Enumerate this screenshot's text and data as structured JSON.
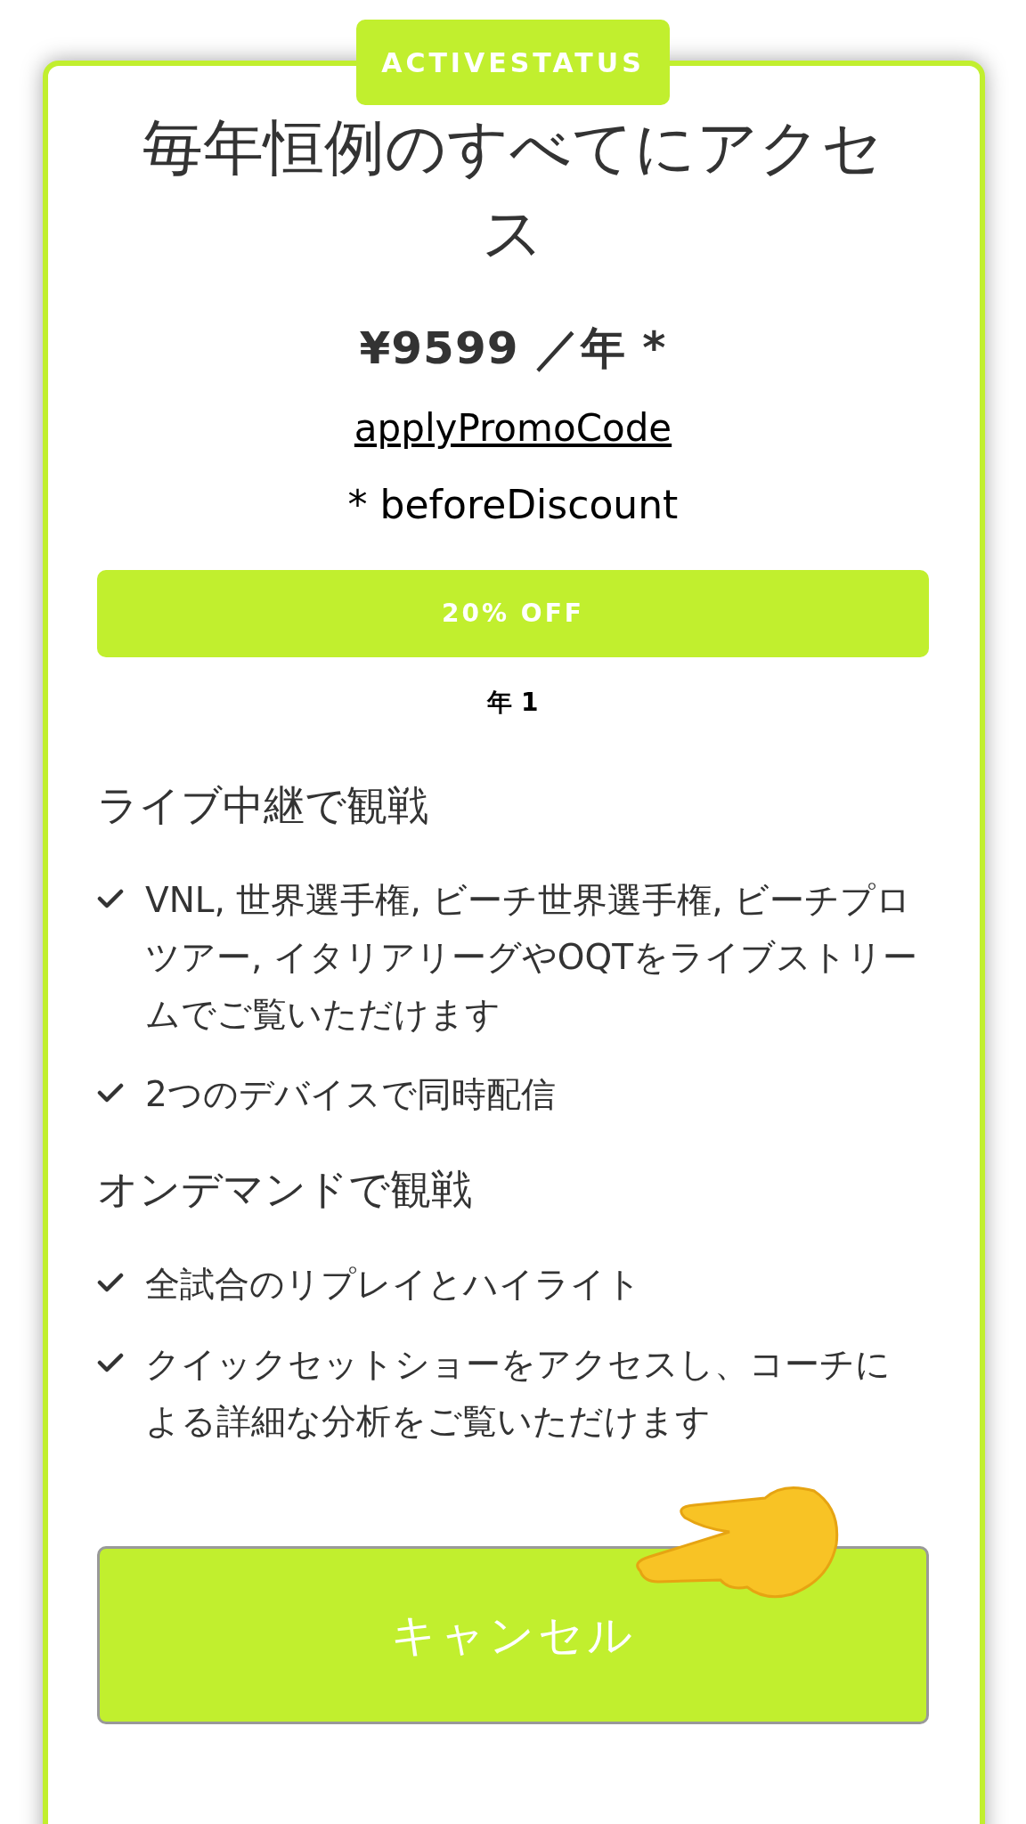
{
  "badge": "ACTIVESTATUS",
  "title": "毎年恒例のすべてにアクセス",
  "price": "¥9599 ／年 *",
  "promo_link": "applyPromoCode",
  "note": "* beforeDiscount",
  "discount_bar": "20% OFF",
  "period": "年 1",
  "sections": [
    {
      "heading": "ライブ中継で観戦",
      "items": [
        "VNL, 世界選手権, ビーチ世界選手権, ビーチプロツアー, イタリアリーグやOQTをライブストリームでご覧いただけます",
        "2つのデバイスで同時配信"
      ]
    },
    {
      "heading": "オンデマンドで観戦",
      "items": [
        "全試合のリプレイとハイライト",
        "クイックセットショーをアクセスし、コーチによる詳細な分析をご覧いただけます"
      ]
    }
  ],
  "cancel_button": "キャンセル"
}
